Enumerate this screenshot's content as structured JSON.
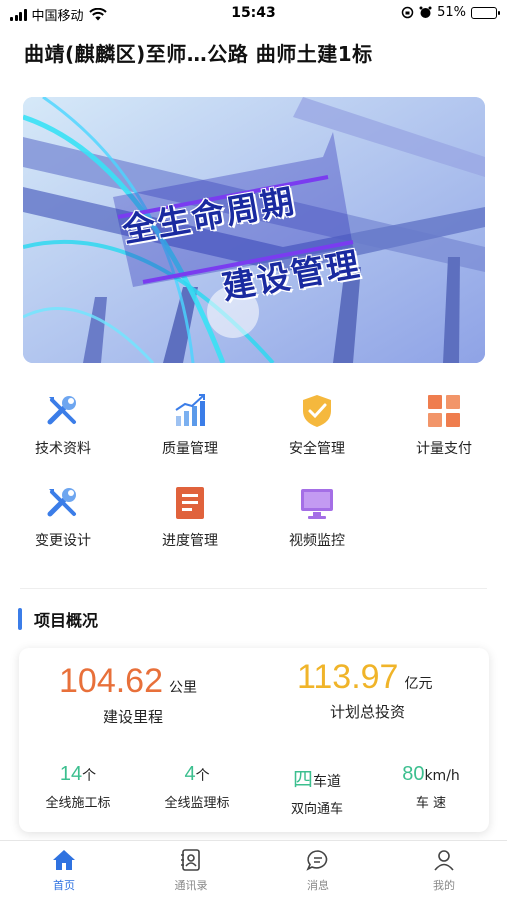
{
  "status_bar": {
    "carrier": "中国移动",
    "time": "15:43",
    "battery": "51%",
    "battery_level": 0.51
  },
  "page": {
    "title": "曲靖(麒麟区)至师…公路  曲师土建1标"
  },
  "banner": {
    "line1": "全生命周期",
    "line2": "建设管理"
  },
  "menu": [
    {
      "label": "技术资料",
      "icon": "wrench-screwdriver-icon"
    },
    {
      "label": "质量管理",
      "icon": "bar-chart-icon"
    },
    {
      "label": "安全管理",
      "icon": "shield-check-icon"
    },
    {
      "label": "计量支付",
      "icon": "grid-icon"
    },
    {
      "label": "变更设计",
      "icon": "wrench-screwdriver-icon"
    },
    {
      "label": "进度管理",
      "icon": "document-icon"
    },
    {
      "label": "视频监控",
      "icon": "monitor-icon"
    }
  ],
  "overview": {
    "title": "项目概况",
    "mileage": {
      "value": "104.62",
      "unit": "公里",
      "label": "建设里程",
      "color": "#e8703a"
    },
    "investment": {
      "value": "113.97",
      "unit": "亿元",
      "label": "计划总投资",
      "color": "#f0b429"
    },
    "stats": [
      {
        "num": "14",
        "unit": "个",
        "label": "全线施工标"
      },
      {
        "num": "4",
        "unit": "个",
        "label": "全线监理标"
      },
      {
        "num": "四",
        "unit": "车道",
        "label": "双向通车"
      },
      {
        "num": "80",
        "unit": "km/h",
        "label": "车    速"
      }
    ]
  },
  "tab_bar": [
    {
      "label": "首页",
      "icon": "home-icon",
      "active": true
    },
    {
      "label": "通讯录",
      "icon": "contacts-icon",
      "active": false
    },
    {
      "label": "消息",
      "icon": "message-icon",
      "active": false
    },
    {
      "label": "我的",
      "icon": "person-icon",
      "active": false
    }
  ],
  "colors": {
    "accent": "#2f72e0",
    "green": "#3cbf8f"
  }
}
